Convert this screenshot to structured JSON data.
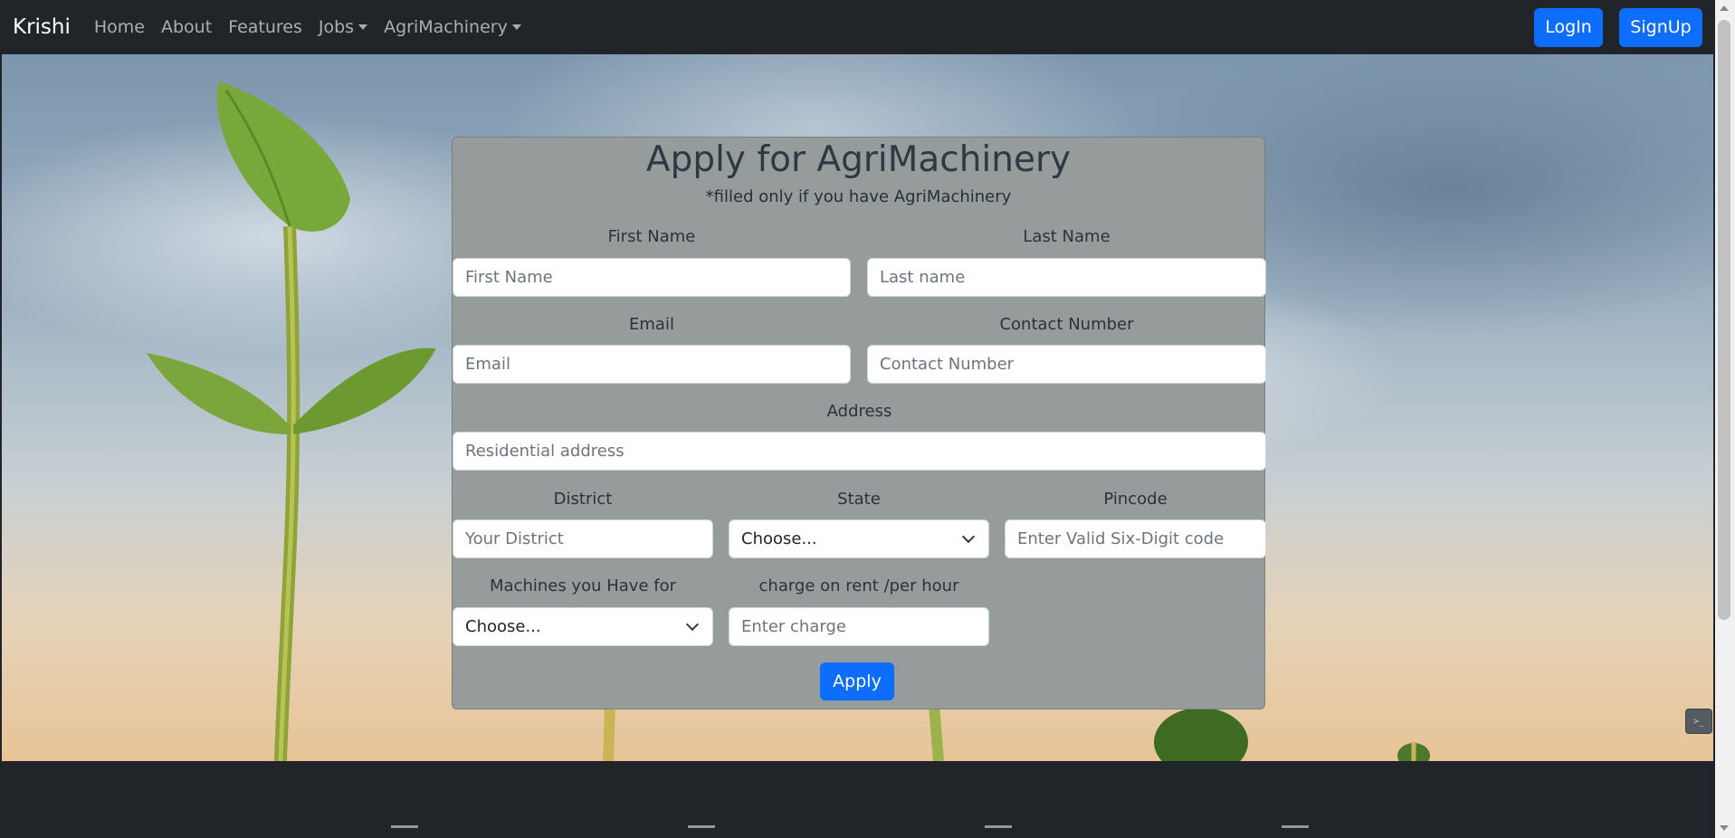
{
  "navbar": {
    "brand": "Krishi",
    "links": [
      "Home",
      "About",
      "Features"
    ],
    "dropdowns": [
      "Jobs",
      "AgriMachinery"
    ],
    "login_label": "LogIn",
    "signup_label": "SignUp"
  },
  "form": {
    "title": "Apply for AgriMachinery",
    "subtitle": "*filled only if you have AgriMachinery",
    "first_name": {
      "label": "First Name",
      "placeholder": "First Name"
    },
    "last_name": {
      "label": "Last Name",
      "placeholder": "Last name"
    },
    "email": {
      "label": "Email",
      "placeholder": "Email"
    },
    "contact": {
      "label": "Contact Number",
      "placeholder": "Contact Number"
    },
    "address": {
      "label": "Address",
      "placeholder": "Residential address"
    },
    "district": {
      "label": "District",
      "placeholder": "Your District"
    },
    "state": {
      "label": "State",
      "selected": "Choose..."
    },
    "pincode": {
      "label": "Pincode",
      "placeholder": "Enter Valid Six-Digit code"
    },
    "machines": {
      "label": "Machines you Have for",
      "selected": "Choose..."
    },
    "charge": {
      "label": "charge on rent /per hour",
      "placeholder": "Enter charge"
    },
    "apply_label": "Apply"
  },
  "colors": {
    "primary": "#0d6efd",
    "navbar_bg": "#212529",
    "card_bg": "#969b9b"
  }
}
